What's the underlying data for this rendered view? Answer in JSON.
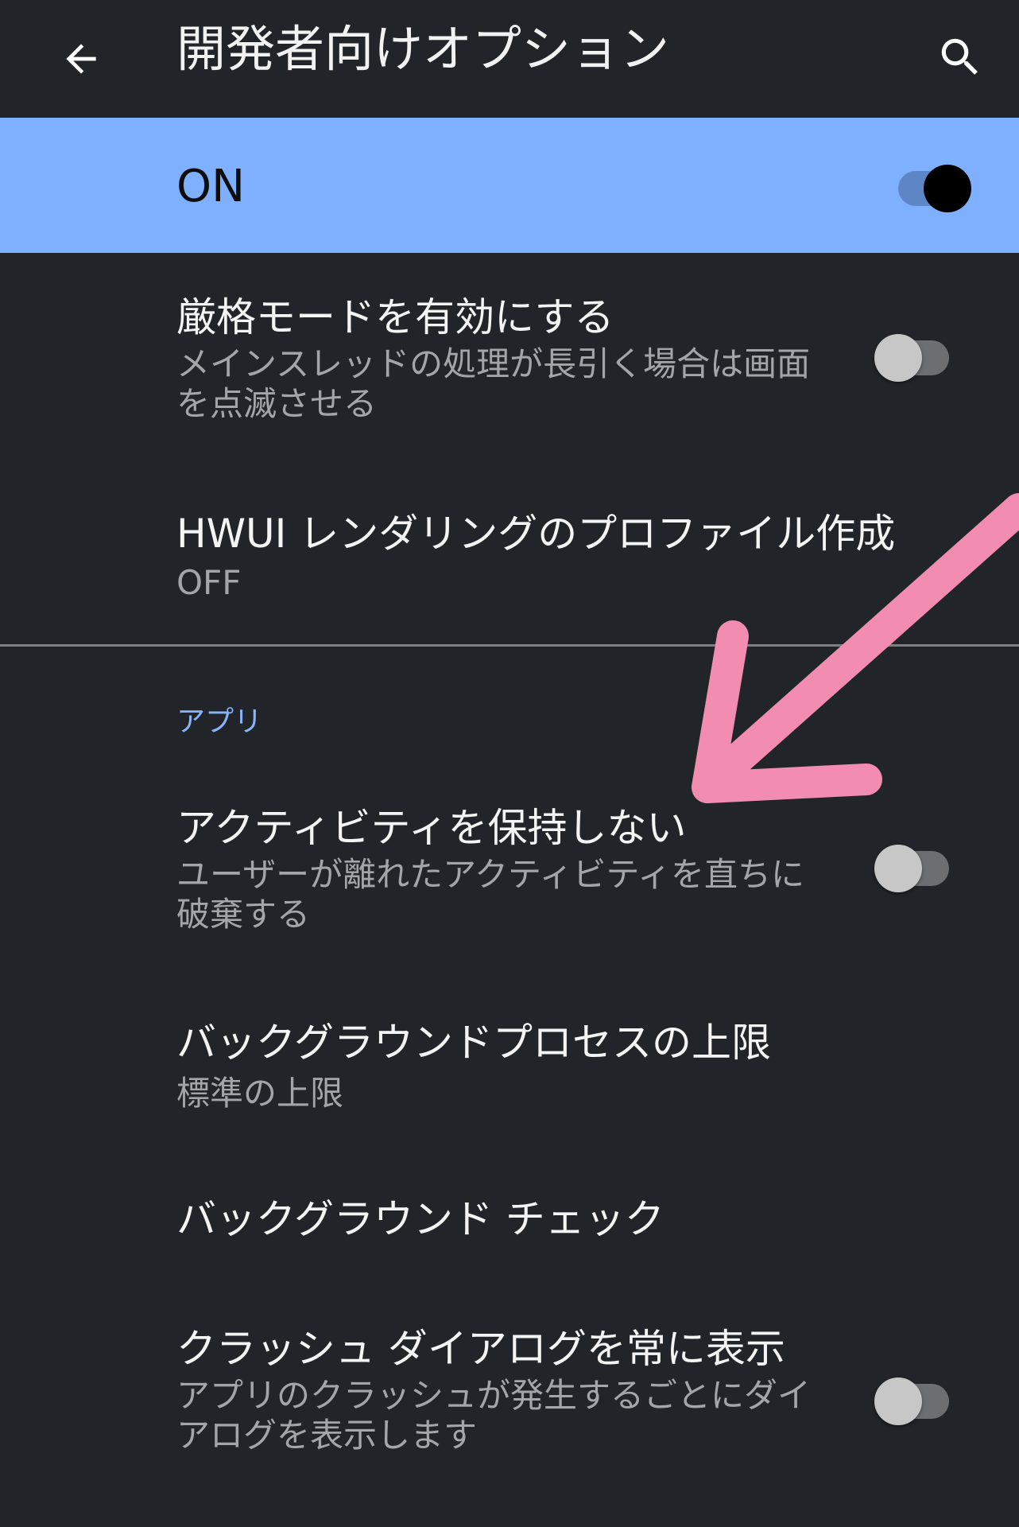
{
  "app_bar": {
    "title": "開発者向けオプション",
    "back_icon": "arrow-back-icon",
    "search_icon": "search-icon"
  },
  "master_switch": {
    "label": "ON",
    "state": true,
    "bar_color": "#7fb0ff"
  },
  "prefs": [
    {
      "title": "厳格モードを有効にする",
      "summary": "メインスレッドの処理が長引く場合は画面を点滅させる",
      "toggle": false
    },
    {
      "title": "HWUI レンダリングのプロファイル作成",
      "summary": "OFF"
    },
    {
      "title": "アクティビティを保持しない",
      "summary": "ユーザーが離れたアクティビティを直ちに破棄する",
      "toggle": false
    },
    {
      "title": "バックグラウンドプロセスの上限",
      "summary": "標準の上限"
    },
    {
      "title": "バックグラウンド チェック"
    },
    {
      "title": "クラッシュ ダイアログを常に表示",
      "summary": "アプリのクラッシュが発生するごとにダイアログを表示します",
      "toggle": false
    }
  ],
  "section_header": "アプリ",
  "colors": {
    "background": "#212529",
    "accent": "#8ab4f8",
    "annotation_arrow": "#f28cb0"
  }
}
